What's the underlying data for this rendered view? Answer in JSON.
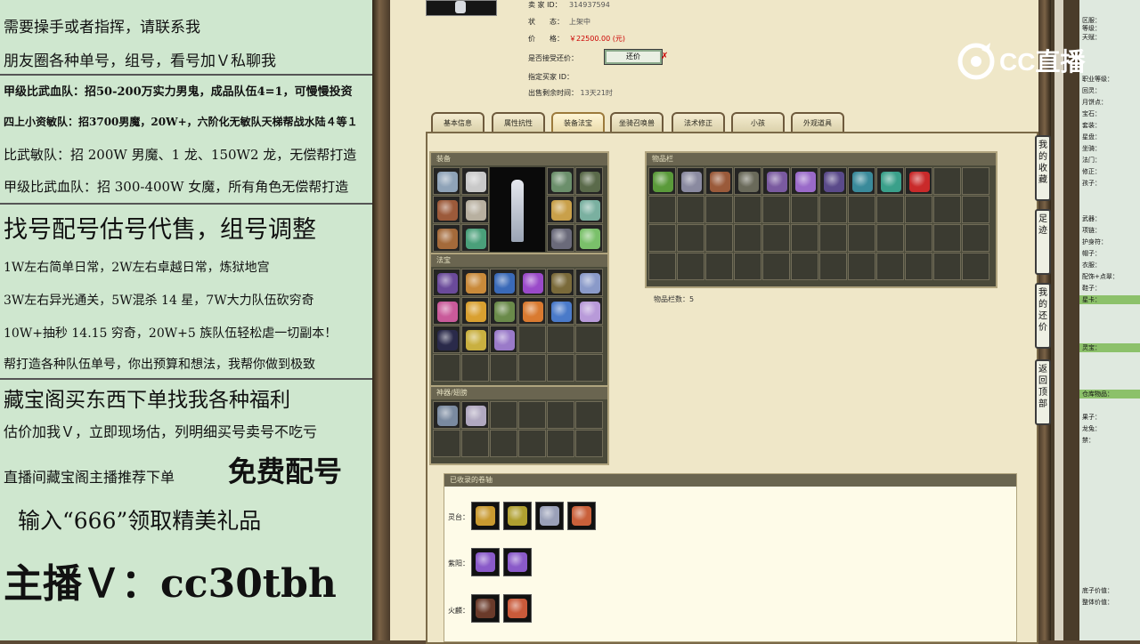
{
  "overlay": {
    "lines": [
      "需要操手或者指挥，请联系我",
      "朋友圈各种单号，组号，看号加Ｖ私聊我",
      "甲级比武血队：招50-200万实力男鬼，成品队伍4=1，可慢慢投资",
      "四上小资敏队：招3700男魔，20W+，六阶化无敏队天梯帮战水陆４等１",
      "比武敏队：招 200W 男魔、1 龙、150W2 龙，无偿帮打造",
      "甲级比武血队：招 300-400W 女魔，所有角色无偿帮打造",
      "找号配号估号代售，组号调整",
      "1W左右简单日常，2W左右卓越日常，炼狱地宫",
      "3W左右异光通关，5W混杀 14 星，7W大力队伍砍穷奇",
      "10W+抽秒 14.15 穷奇，20W+5 族队伍轻松虐一切副本！",
      "帮打造各种队伍单号，你出预算和想法，我帮你做到极致",
      "藏宝阁买东西下单找我各种福利",
      "估价加我Ｖ，立即现场估，列明细买号卖号不吃亏",
      "直播间藏宝阁主播推荐下单",
      "免费配号",
      "输入“666”领取精美礼品",
      "主播Ｖ：cc30tbh"
    ]
  },
  "listing": {
    "seller_label": "卖 家 ID：",
    "seller_id": "314937594",
    "status_label": "状　　态：",
    "status": "上架中",
    "price_label": "价　　格：",
    "price": "￥22500.00 (元)",
    "haggle_label": "是否接受还价：",
    "haggle_button": "还价",
    "buyer_label": "指定买家 ID：",
    "time_label": "出售剩余时间：",
    "time_left": "13天21时"
  },
  "tabs": [
    "基本信息",
    "属性抗性",
    "装备法宝",
    "坐骑召唤兽",
    "法术修正",
    "小孩",
    "外观道具"
  ],
  "active_tab": 2,
  "panels": {
    "equip": "装备",
    "fabao": "法宝",
    "hidden": "神器/翅膀",
    "inventory": "物品栏",
    "inventory_count": "物品栏数：5",
    "collected": "已收录的卷轴"
  },
  "collected_rows": [
    "灵台：",
    "紫阳：",
    "火麟："
  ],
  "side_buttons": [
    "我的收藏",
    "足迹",
    "我的还价",
    "返回顶部"
  ],
  "right_panel": {
    "rows": [
      {
        "n": "1",
        "t": "区服：",
        "hl": false
      },
      {
        "n": "2",
        "t": "等级：",
        "hl": false
      },
      {
        "n": "3",
        "t": "天赋：",
        "hl": false
      },
      {
        "n": "7",
        "t": "职业等级：",
        "hl": false
      },
      {
        "n": "8",
        "t": "回灵：",
        "hl": false
      },
      {
        "n": "9",
        "t": "月饼点：",
        "hl": false
      },
      {
        "n": "10",
        "t": "宝石：",
        "hl": false
      },
      {
        "n": "11",
        "t": "套装：",
        "hl": false
      },
      {
        "n": "12",
        "t": "星盘：",
        "hl": false
      },
      {
        "n": "13",
        "t": "坐骑：",
        "hl": false
      },
      {
        "n": "14",
        "t": "法门：",
        "hl": false
      },
      {
        "n": "15",
        "t": "修正：",
        "hl": false
      },
      {
        "n": "16",
        "t": "孩子：",
        "hl": false
      },
      {
        "n": "20",
        "t": "武器：",
        "hl": false
      },
      {
        "n": "21",
        "t": "项链：",
        "hl": false
      },
      {
        "n": "22",
        "t": "护身符：",
        "hl": false
      },
      {
        "n": "23",
        "t": "帽子：",
        "hl": false
      },
      {
        "n": "24",
        "t": "衣服：",
        "hl": false
      },
      {
        "n": "25",
        "t": "配饰+点翠：",
        "hl": false
      },
      {
        "n": "26",
        "t": "鞋子：",
        "hl": false
      },
      {
        "n": "27",
        "t": "星卡：",
        "hl": true
      },
      {
        "n": "31",
        "t": "灵宝：",
        "hl": true
      },
      {
        "n": "37",
        "t": "仓库物品：",
        "hl": true
      },
      {
        "n": "39",
        "t": "果子：",
        "hl": false
      },
      {
        "n": "40",
        "t": "龙兔：",
        "hl": false
      },
      {
        "n": "41",
        "t": "禁：",
        "hl": false
      },
      {
        "n": "61",
        "t": "底子价值：",
        "hl": false
      },
      {
        "n": "62",
        "t": "整体价值：",
        "hl": false
      }
    ]
  },
  "logo_text": "CC直播",
  "colors": {
    "price": "#cc0000",
    "highlight": "#8cc16a",
    "overlay_bg": "#cfe7cf",
    "paper": "#efe7c8"
  }
}
